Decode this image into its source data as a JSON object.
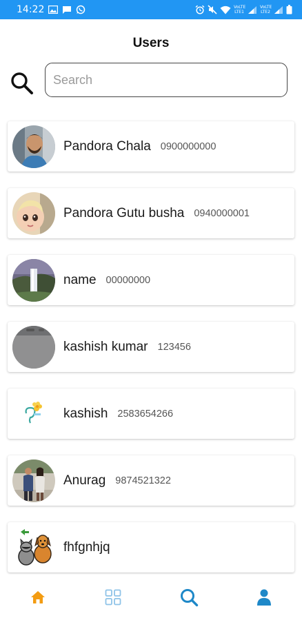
{
  "status_bar": {
    "time": "14:22",
    "left_icons": [
      "image-icon",
      "message-icon",
      "whatsapp-icon"
    ],
    "right_icons": [
      "alarm-icon",
      "mute-icon",
      "wifi-icon",
      "signal-icon",
      "signal-icon",
      "battery-icon"
    ],
    "network_labels": [
      "VoLTE LTE1",
      "VoLTE LTE2"
    ]
  },
  "header": {
    "title": "Users"
  },
  "search": {
    "placeholder": "Search",
    "value": ""
  },
  "users": [
    {
      "name": "Pandora Chala",
      "phone": "0900000000"
    },
    {
      "name": "Pandora Gutu busha",
      "phone": "0940000001"
    },
    {
      "name": "name",
      "phone": "00000000"
    },
    {
      "name": "kashish kumar",
      "phone": "123456"
    },
    {
      "name": "kashish",
      "phone": "2583654266"
    },
    {
      "name": "Anurag",
      "phone": "9874521322"
    },
    {
      "name": "fhfgnhjq",
      "phone": ""
    }
  ],
  "bottom_nav": {
    "items": [
      "home-icon",
      "grid-icon",
      "search-icon",
      "profile-icon"
    ],
    "active_color": "#F39C12",
    "inactive_color": "#8EC3E8",
    "accent_color": "#1E88C8"
  },
  "colors": {
    "status_bar": "#2196F3"
  }
}
